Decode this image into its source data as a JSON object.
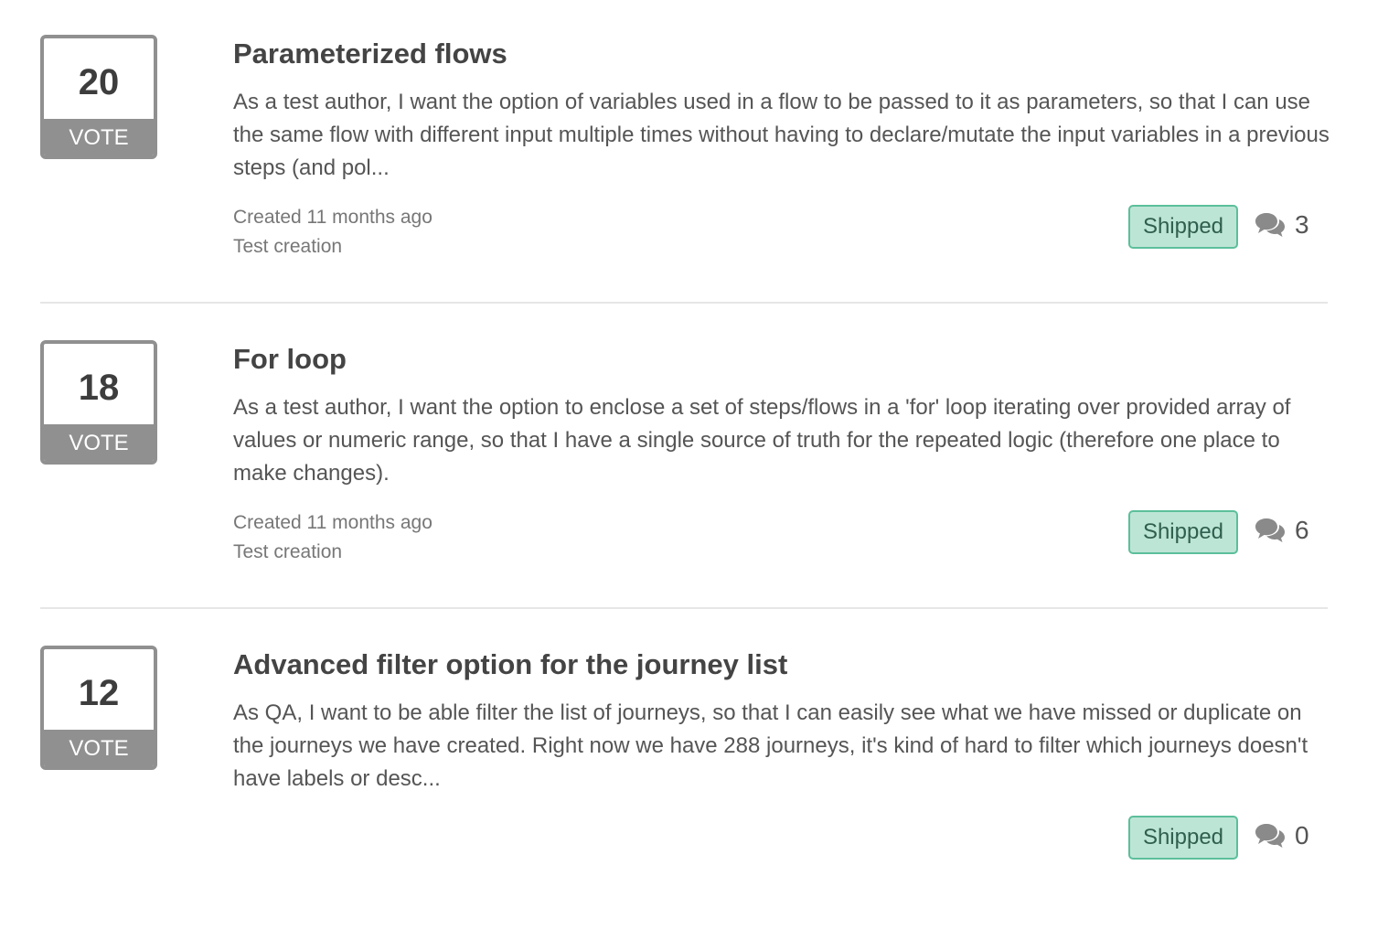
{
  "ideas": [
    {
      "votes": "20",
      "vote_label": "VOTE",
      "title": "Parameterized flows",
      "description": "As a test author, I want the option of variables used in a flow to be passed to it as parameters, so that I can use the same flow with different input multiple times without having to declare/mutate the input variables in a previous steps (and pol...",
      "created": "Created 11 months ago",
      "category": "Test creation",
      "status": "Shipped",
      "comments": "3",
      "comment_icon": "comments-icon"
    },
    {
      "votes": "18",
      "vote_label": "VOTE",
      "title": "For loop",
      "description": "As a test author, I want the option to enclose a set of steps/flows in a 'for' loop iterating over provided array of values or numeric range, so that I have a single source of truth for the repeated logic (therefore one place to make changes).",
      "created": "Created 11 months ago",
      "category": "Test creation",
      "status": "Shipped",
      "comments": "6",
      "comment_icon": "comments-icon"
    },
    {
      "votes": "12",
      "vote_label": "VOTE",
      "title": "Advanced filter option for the journey list",
      "description": "As QA, I want to be able filter the list of journeys, so that I can easily see what we have missed or duplicate on the journeys we have created. Right now we have 288 journeys, it's kind of hard to filter which journeys doesn't have labels or desc...",
      "status": "Shipped",
      "comments": "0",
      "comment_icon": "comments-icon"
    }
  ],
  "colors": {
    "vote_border": "#909090",
    "status_bg": "#bde5d6",
    "status_border": "#5cbf9b",
    "divider": "#e6e6e6"
  }
}
